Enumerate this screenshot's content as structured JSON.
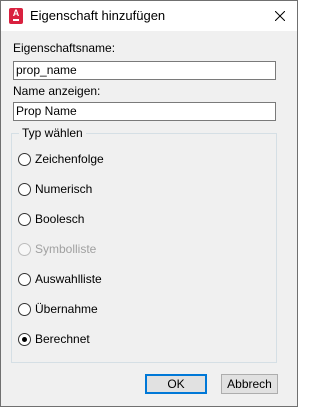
{
  "window": {
    "title": "Eigenschaft hinzufügen",
    "app_icon_letter": "A"
  },
  "fields": {
    "name_label": "Eigenschaftsname:",
    "name_value": "prop_name",
    "display_label": "Name anzeigen:",
    "display_value": "Prop Name"
  },
  "type_group": {
    "legend": "Typ wählen",
    "options": [
      {
        "label": "Zeichenfolge",
        "checked": false,
        "disabled": false
      },
      {
        "label": "Numerisch",
        "checked": false,
        "disabled": false
      },
      {
        "label": "Boolesch",
        "checked": false,
        "disabled": false
      },
      {
        "label": "Symbolliste",
        "checked": false,
        "disabled": true
      },
      {
        "label": "Auswahlliste",
        "checked": false,
        "disabled": false
      },
      {
        "label": "Übernahme",
        "checked": false,
        "disabled": false
      },
      {
        "label": "Berechnet",
        "checked": true,
        "disabled": false
      }
    ]
  },
  "buttons": {
    "ok": "OK",
    "cancel": "Abbrech"
  }
}
